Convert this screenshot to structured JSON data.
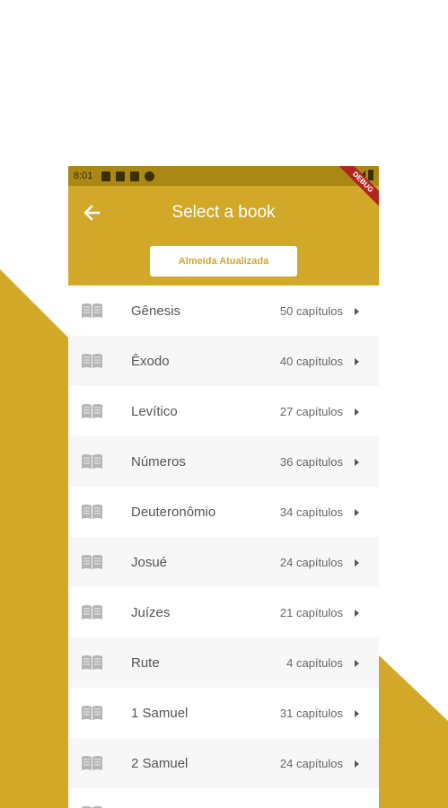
{
  "colors": {
    "accent": "#d2a829",
    "status_bar": "#a98814",
    "debug_banner": "#b0261f",
    "row_alt": "#f7f7f7"
  },
  "status_bar": {
    "time": "8:01",
    "debug_label": "DEBUG"
  },
  "app_bar": {
    "back_icon": "arrow-left-icon",
    "title": "Select a book",
    "version_label": "Almeida Atualizada"
  },
  "books": [
    {
      "name": "Gênesis",
      "chapters": "50 capítulos"
    },
    {
      "name": "Êxodo",
      "chapters": "40 capítulos"
    },
    {
      "name": "Levítico",
      "chapters": "27 capítulos"
    },
    {
      "name": "Números",
      "chapters": "36 capítulos"
    },
    {
      "name": "Deuteronômio",
      "chapters": "34 capítulos"
    },
    {
      "name": "Josué",
      "chapters": "24 capítulos"
    },
    {
      "name": "Juízes",
      "chapters": "21 capítulos"
    },
    {
      "name": "Rute",
      "chapters": "4 capítulos"
    },
    {
      "name": "1 Samuel",
      "chapters": "31 capítulos"
    },
    {
      "name": "2 Samuel",
      "chapters": "24 capítulos"
    },
    {
      "name": "",
      "chapters": ""
    }
  ]
}
